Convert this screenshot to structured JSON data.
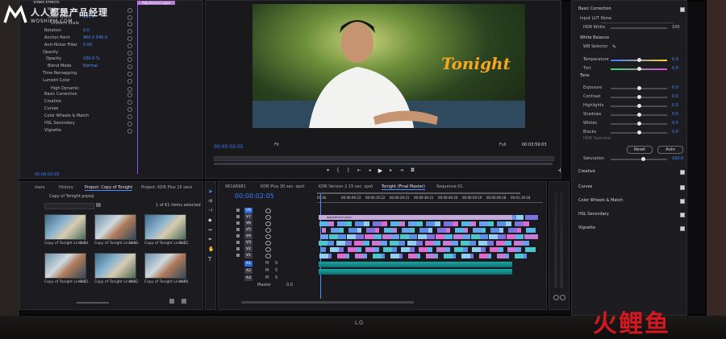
{
  "watermark": {
    "title": "人人都是产品经理",
    "url": "WOSHIPM.COM"
  },
  "effect_controls": {
    "header": "Video Effects",
    "rows": [
      {
        "label": "Motion",
        "value": ""
      },
      {
        "label": "Scale Width",
        "value": "100.0"
      },
      {
        "label": "Uniform Scale",
        "value": ""
      },
      {
        "label": "Rotation",
        "value": "0.0"
      },
      {
        "label": "Anchor Point",
        "value": "960.0   540.0"
      },
      {
        "label": "Anti-flicker Filter",
        "value": "0.00"
      },
      {
        "label": "Opacity",
        "value": ""
      },
      {
        "label": "Opacity",
        "value": "100.0 %"
      },
      {
        "label": "Blend Mode",
        "value": "Normal"
      },
      {
        "label": "Time Remapping",
        "value": ""
      },
      {
        "label": "Lumetri Color",
        "value": ""
      },
      {
        "label": "High Dynamic",
        "value": ""
      },
      {
        "label": "Basic Correction",
        "value": ""
      },
      {
        "label": "Creative",
        "value": ""
      },
      {
        "label": "Curves",
        "value": ""
      },
      {
        "label": "Color Wheels & Match",
        "value": ""
      },
      {
        "label": "HSL Secondary",
        "value": ""
      },
      {
        "label": "Vignette",
        "value": ""
      }
    ],
    "timecode": "00:00:02:05",
    "clip_tag": "Adjustment Layer"
  },
  "program": {
    "overlay_text": "Tonight",
    "timecode": "00:00:02:05",
    "fit": "Fit",
    "quality": "Full",
    "duration": "00:03:59:03"
  },
  "project": {
    "tabs": [
      "rkers",
      "History",
      "Project: Copy of Tonight",
      "Project: KDR Plus 15 secs"
    ],
    "file": "Copy of Tonight.prproj",
    "selection": "1 of 61 items selected",
    "items": [
      {
        "name": "Copy of Tonight Linked...",
        "dur": "1:04"
      },
      {
        "name": "Copy of Tonight Linked...",
        "dur": "3:16"
      },
      {
        "name": "Copy of Tonight Linked...",
        "dur": "1:22"
      },
      {
        "name": "Copy of Tonight Linked...",
        "dur": "0:22"
      },
      {
        "name": "Copy of Tonight Linked...",
        "dur": "0:22"
      },
      {
        "name": "Copy of Tonight Linked...",
        "dur": "0:19"
      }
    ]
  },
  "timeline": {
    "tabs": [
      "961A6981",
      "KDR Plus 30 sec. spot",
      "KDR Version 2 15 sec. spot",
      "Tonight (Final Master)",
      "Sequence 01"
    ],
    "timecode": "00:00:02:05",
    "ruler": [
      "00:00",
      "00:00:09:23",
      "00:00:19:22",
      "00:00:29:21",
      "00:00:39:21",
      "00:00:49:20",
      "00:00:59:19",
      "00:00:09:18",
      "00:01:19:18"
    ],
    "clip_label": "Adjustment Layer",
    "video_tracks": [
      "V8",
      "V7",
      "V6",
      "V5",
      "V4",
      "V3",
      "V2",
      "V1"
    ],
    "audio_tracks": [
      "A1",
      "A2",
      "A3"
    ],
    "master": "Master",
    "master_value": "0.0"
  },
  "lumetri": {
    "basic_correction": "Basic Correction",
    "input_lut": "Input LUT",
    "input_lut_value": "None",
    "hdr_white": "HDR White",
    "hdr_white_value": "100",
    "white_balance": "White Balance",
    "wb_selector": "WB Selector",
    "tone": "Tone",
    "sliders": [
      {
        "label": "Temperature",
        "value": "0.0",
        "pos": 0.5,
        "gradient": "linear-gradient(90deg,#3a7bff,#ffd23a)"
      },
      {
        "label": "Tint",
        "value": "0.0",
        "pos": 0.5,
        "gradient": "linear-gradient(90deg,#38e06a,#e04ae0)"
      },
      {
        "label": "Exposure",
        "value": "0.0",
        "pos": 0.5
      },
      {
        "label": "Contrast",
        "value": "0.0",
        "pos": 0.5
      },
      {
        "label": "Highlights",
        "value": "0.0",
        "pos": 0.5
      },
      {
        "label": "Shadows",
        "value": "0.0",
        "pos": 0.5
      },
      {
        "label": "Whites",
        "value": "0.0",
        "pos": 0.5
      },
      {
        "label": "Blacks",
        "value": "0.0",
        "pos": 0.5
      }
    ],
    "hdr_specular": "HDR Specular",
    "reset": "Reset",
    "auto": "Auto",
    "saturation": "Saturation",
    "saturation_value": "100.0",
    "sections": [
      "Creative",
      "Curves",
      "Color Wheels & Match",
      "HSL Secondary",
      "Vignette"
    ]
  },
  "stand": {
    "logo": "LG"
  },
  "brand": "火鲤鱼",
  "colors": {
    "accent": "#3d7dff",
    "overlay": "#f5a623",
    "brand": "#d3181f"
  }
}
